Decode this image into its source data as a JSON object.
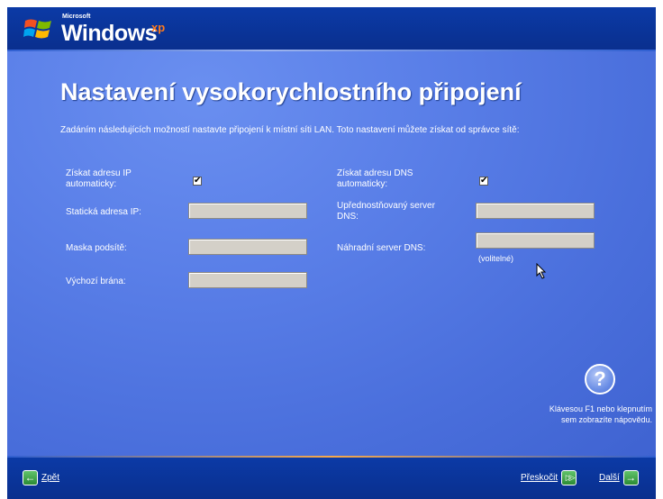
{
  "brand": {
    "microsoft": "Microsoft",
    "windows": "Windows",
    "xp": "xp"
  },
  "page": {
    "title": "Nastavení vysokorychlostního připojení",
    "intro": "Zadáním následujících možností nastavte připojení k místní síti LAN. Toto nastavení můžete získat od správce sítě:"
  },
  "form": {
    "ip_auto_label_1": "Získat adresu IP",
    "ip_auto_label_2": "automaticky:",
    "ip_auto_checked": true,
    "static_ip_label": "Statická adresa IP:",
    "subnet_label": "Maska podsítě:",
    "gateway_label": "Výchozí brána:",
    "dns_auto_label_1": "Získat adresu DNS",
    "dns_auto_label_2": "automaticky:",
    "dns_auto_checked": true,
    "preferred_dns_label_1": "Upřednostňovaný server",
    "preferred_dns_label_2": "DNS:",
    "alternate_dns_label": "Náhradní server DNS:",
    "optional_note": "(volitelné)",
    "check_mark": "✔"
  },
  "help": {
    "icon_symbol": "?",
    "text_1": "Klávesou F1 nebo klepnutím",
    "text_2": "sem zobrazíte nápovědu."
  },
  "nav": {
    "back_label": "Zpět",
    "skip_label": "Přeskočit",
    "next_label": "Další",
    "back_icon": "←",
    "skip_icon": "▷▷",
    "next_icon": "→"
  },
  "colors": {
    "bar": "#0b3aa6",
    "panel": "#5a7fe8",
    "accent": "#ff7b1c",
    "nav_green": "#2a8b34"
  }
}
